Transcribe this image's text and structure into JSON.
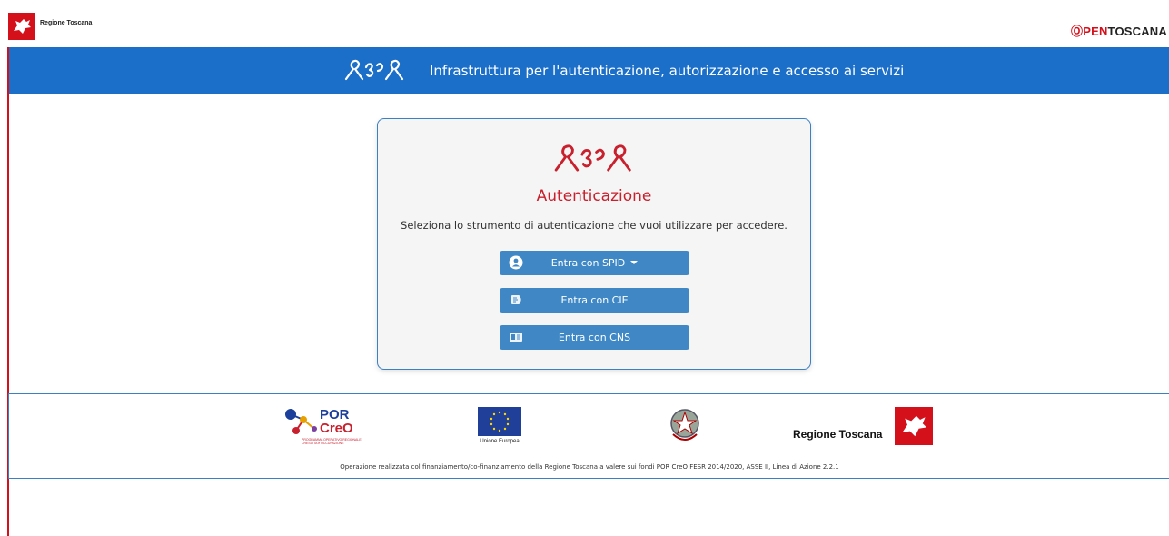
{
  "header": {
    "region_name": "Regione Toscana",
    "brand": {
      "o": "Ⓞ",
      "pen": "PEN",
      "tos": "TOSCANA"
    }
  },
  "band": {
    "title": "Infrastruttura per l'autenticazione, autorizzazione e accesso ai servizi"
  },
  "login": {
    "title": "Autenticazione",
    "subtitle": "Seleziona lo strumento di autenticazione che vuoi utilizzare per accedere.",
    "buttons": {
      "spid": "Entra con SPID",
      "cie": "Entra con CIE",
      "cns": "Entra con CNS"
    }
  },
  "footer": {
    "por_line1": "POR",
    "por_line2": "CreO",
    "por_sub": "PROGRAMMA OPERATIVO REGIONALE CRESCITA e OCCUPAZIONE",
    "eu_label": "Unione Europea",
    "region_name": "Regione Toscana",
    "note": "Operazione realizzata col finanziamento/co-finanziamento della Regione Toscana a valere sui fondi POR CreO FESR 2014/2020, ASSE II, Linea di Azione 2.2.1"
  },
  "colors": {
    "brand_red": "#d4101b",
    "band_blue": "#1b6fc8",
    "button_blue": "#3f88c5",
    "title_red": "#c8202d"
  },
  "icons": [
    "pegasus-logo-icon",
    "arpa-logo-icon",
    "user-circle-icon",
    "cie-card-icon",
    "cns-card-icon",
    "caret-down-icon",
    "eu-flag-icon",
    "italian-emblem-icon"
  ]
}
